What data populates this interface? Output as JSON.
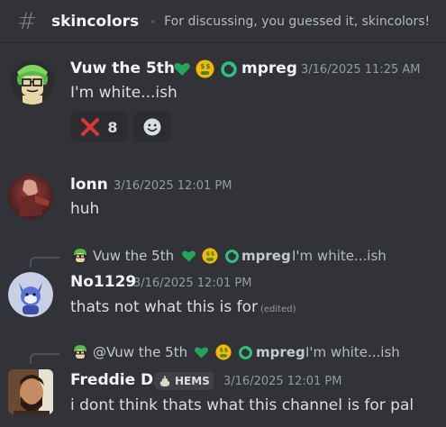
{
  "channel": {
    "name": "skincolors",
    "topic": "For discussing, you guessed it, skincolors!"
  },
  "messages": [
    {
      "author": "Vuw the 5th",
      "nickname_suffix": "mpreg",
      "timestamp": "3/16/2025 11:25 AM",
      "text": "I'm white...ish",
      "reactions": [
        {
          "emoji": "cross-mark",
          "count": "8"
        },
        {
          "emoji": "add-reaction",
          "count": ""
        }
      ]
    },
    {
      "author": "lonn",
      "timestamp": "3/16/2025 12:01 PM",
      "text": "huh"
    },
    {
      "reply": {
        "author": "Vuw the 5th",
        "suffix": "mpreg",
        "text": "I'm white...ish"
      },
      "author": "No1129",
      "timestamp": "3/16/2025 12:01 PM",
      "text": "thats not what this is for",
      "edited": "(edited)"
    },
    {
      "reply": {
        "author": "@Vuw the 5th",
        "suffix": "mpreg",
        "text": "I'm white...ish"
      },
      "author": "Freddie D.",
      "role_tag": "HEMS",
      "timestamp": "3/16/2025 12:01 PM",
      "text": "i dont think thats what this channel is for pal"
    }
  ],
  "colors": {
    "background": "#313338",
    "green_heart": "#23a55a",
    "red_cross": "#da373c",
    "username": "#f2f3f5",
    "timestamp": "#949ba4"
  }
}
